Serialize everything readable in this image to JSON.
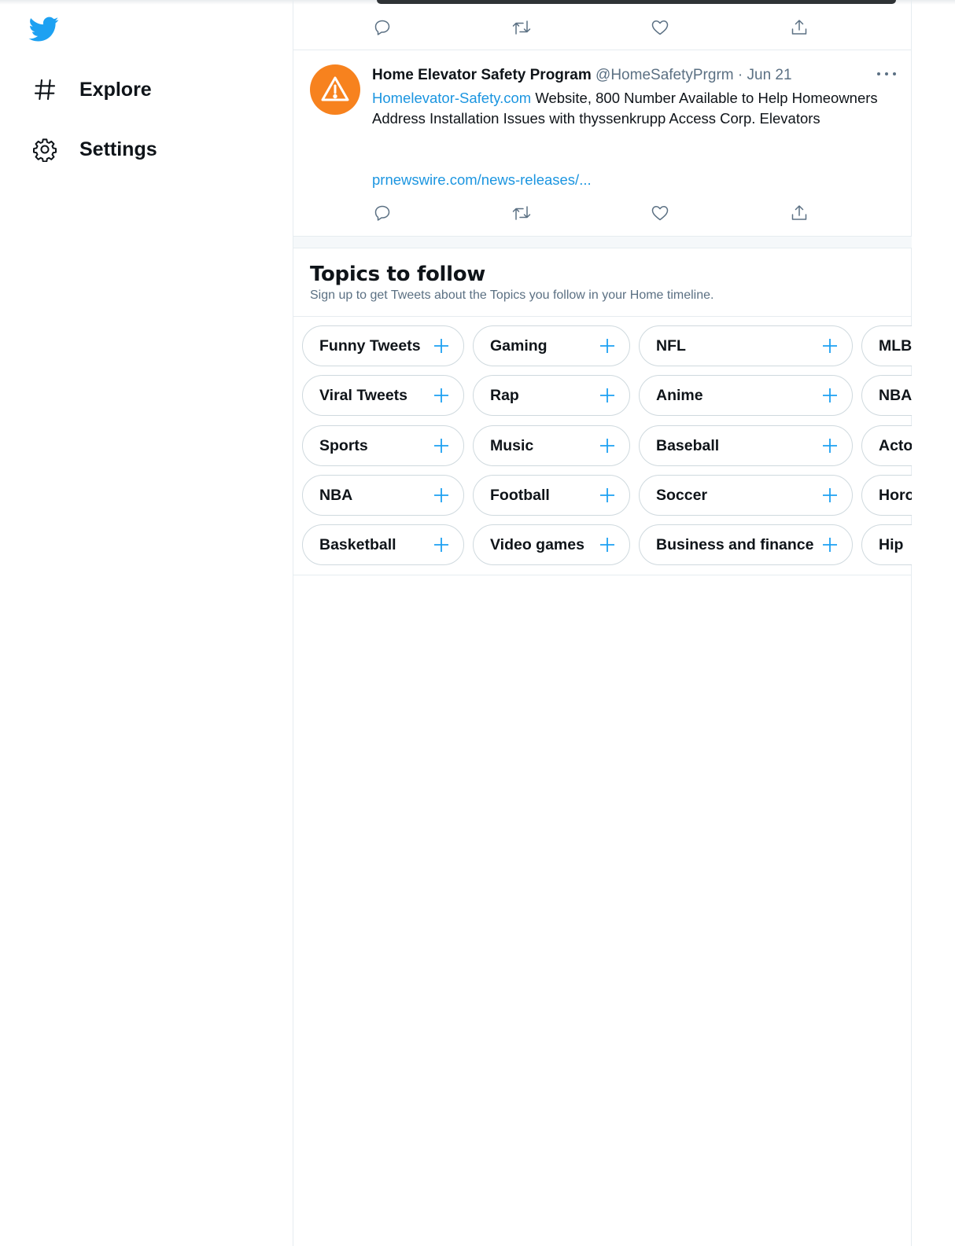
{
  "sidebar": {
    "logo_icon": "twitter-bird-icon",
    "items": [
      {
        "label": "Explore",
        "icon": "hashtag-icon"
      },
      {
        "label": "Settings",
        "icon": "gear-icon"
      }
    ]
  },
  "tweet": {
    "author_name": "Home Elevator Safety Program",
    "handle": "@HomeSafetyPrgrm",
    "separator": "·",
    "date": "Jun 21",
    "text_link": "Homelevator-Safety.com",
    "text_body": " Website, 800 Number Available to Help Homeowners Address Installation Issues with thyssenkrupp Access Corp. Elevators",
    "url": "prnewswire.com/news-releases/...",
    "avatar_icon": "warning-triangle-icon"
  },
  "actions": [
    "reply-icon",
    "retweet-icon",
    "like-icon",
    "share-icon"
  ],
  "topics": {
    "title": "Topics to follow",
    "subtitle": "Sign up to get Tweets about the Topics you follow in your Home timeline.",
    "items": [
      [
        "Funny Tweets",
        "Gaming",
        "NFL",
        "MLB"
      ],
      [
        "Viral Tweets",
        "Rap",
        "Anime",
        "NBA"
      ],
      [
        "Sports",
        "Music",
        "Baseball",
        "Acto"
      ],
      [
        "NBA",
        "Football",
        "Soccer",
        "Horo"
      ],
      [
        "Basketball",
        "Video games",
        "Business and finance",
        "Hip"
      ]
    ]
  },
  "colors": {
    "accent": "#1da1f2",
    "link": "#1b95e0",
    "avatar": "#f7821e",
    "muted": "#5b7083"
  }
}
